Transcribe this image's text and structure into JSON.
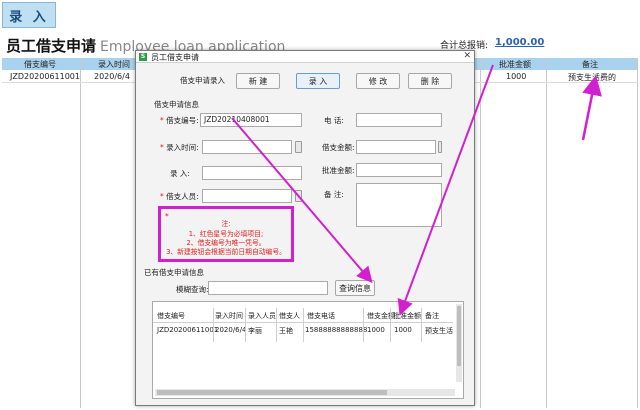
{
  "toolbar": {
    "entry_label": "录 入"
  },
  "header": {
    "title_cn": "员工借支申请",
    "title_en": "Employee loan application",
    "total_label": "合计总报销:",
    "total_value": "1,000.00"
  },
  "sheet": {
    "columns": [
      "借支编号",
      "录入时间",
      "批准金额",
      "备注"
    ],
    "row": {
      "id": "JZD20200611001",
      "time": "2020/6/4",
      "approved": "1000",
      "remark": "预支生活费的"
    }
  },
  "dialog": {
    "title": "员工借支申请",
    "close_glyph": "✕",
    "section_entry": "借支申请录入",
    "buttons": {
      "new": "新 建",
      "entry": "录 入",
      "modify": "修 改",
      "delete": "删 除"
    },
    "section_info": "借支申请信息",
    "fields": {
      "id_label": "借支编号:",
      "id_value": "JZD20210408001",
      "time_label": "录入时间:",
      "enterer_label": "录 入:",
      "borrower_label": "借支人员:",
      "phone_label": "电 话:",
      "amount_label": "借支金额:",
      "approved_label": "批准金额:",
      "remark_label": "备 注:"
    },
    "note": {
      "title": "注:",
      "lines": [
        "1、红色星号为必填项目;",
        "2、借支编号为唯一凭号。",
        "3、新建按钮会根据当前日期自动编号。"
      ]
    },
    "section_list": "已有借支申请信息",
    "search_label": "模糊查询:",
    "search_button": "查询信息",
    "grid": {
      "columns": [
        "借支编号",
        "录入时间",
        "录入人员",
        "借支人",
        "借支电话",
        "借支金额",
        "批准金额",
        "备注"
      ],
      "row": [
        "JZD20200611001",
        "2020/6/4",
        "李丽",
        "王艳",
        "15888888888888",
        "1000",
        "1000",
        "预支生活"
      ]
    }
  }
}
